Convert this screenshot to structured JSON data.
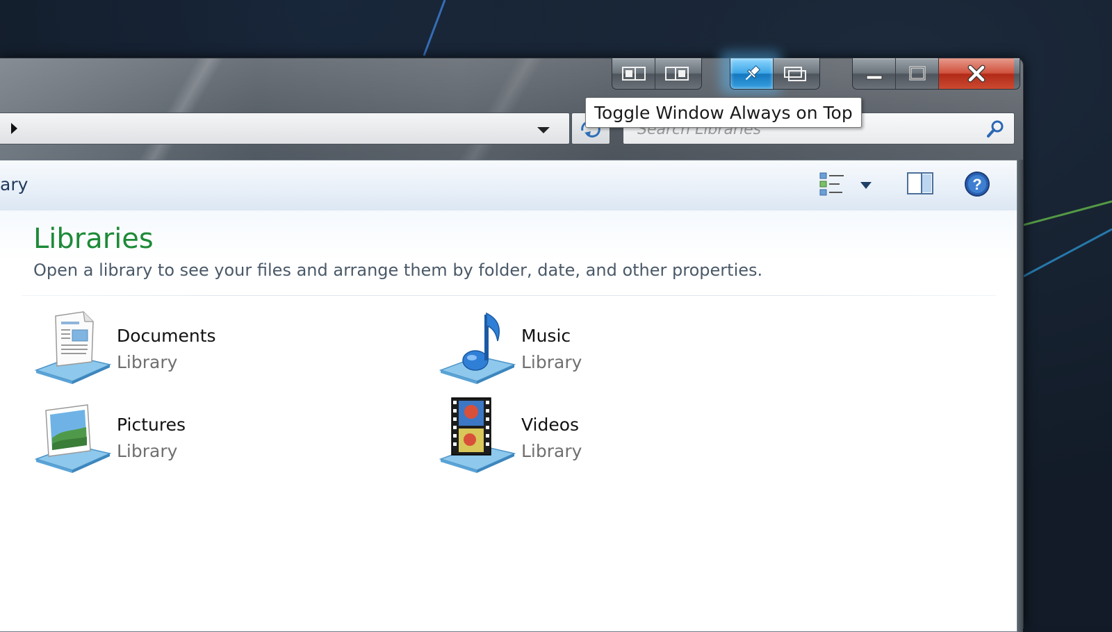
{
  "window": {
    "tooltip": "Toggle Window Always on Top"
  },
  "caption_buttons": {
    "group1": [
      "dock-left-icon",
      "dock-right-icon"
    ],
    "group2": [
      "pin-icon",
      "cascade-icon"
    ],
    "group3": [
      "minimize-icon",
      "maximize-icon",
      "close-icon"
    ],
    "active": "pin-icon",
    "active_color": "#3ea7e6",
    "close_color": "#c8452e"
  },
  "search": {
    "placeholder": "Search Libraries"
  },
  "command_bar": {
    "partial_label": "ary"
  },
  "main": {
    "title": "Libraries",
    "subtitle": "Open a library to see your files and arrange them by folder, date, and other properties.",
    "title_color": "#1d8a37",
    "libraries": [
      {
        "name": "Documents",
        "kind": "Library",
        "icon": "documents-library-icon"
      },
      {
        "name": "Music",
        "kind": "Library",
        "icon": "music-library-icon"
      },
      {
        "name": "Pictures",
        "kind": "Library",
        "icon": "pictures-library-icon"
      },
      {
        "name": "Videos",
        "kind": "Library",
        "icon": "videos-library-icon"
      }
    ]
  }
}
